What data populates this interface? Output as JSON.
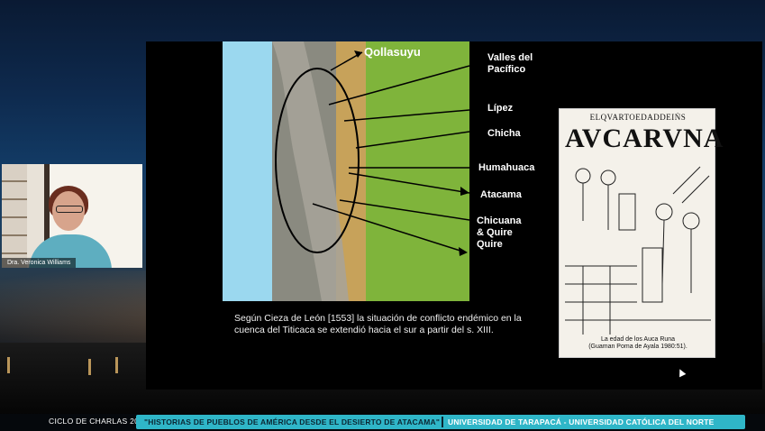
{
  "slide": {
    "map_title": "Qollasuyu",
    "labels": [
      "Valles del\nPacífico",
      "Lípez",
      "Chicha",
      "Humahuaca",
      "Atacama",
      "Chicuana\n& Quire\nQuire"
    ],
    "caption": "Según Cieza de León [1553] la situación de conflicto endémico en la cuenca del Titicaca se extendió hacia el sur a partir del s. XIII.",
    "drawing": {
      "title": "ELQVARTOEDADDEIṄS",
      "heading": "AVCARVNA",
      "caption_line1": "La edad de los Auca Runa",
      "caption_line2": "(Guaman Poma de Ayala 1980:51)."
    }
  },
  "webcam": {
    "name": "Dra. Veronica Williams"
  },
  "footer": {
    "series": "CICLO DE CHARLAS 2020",
    "title": "\"HISTORIAS DE PUEBLOS DE AMÉRICA DESDE EL DESIERTO DE ATACAMA\"",
    "universities": "UNIVERSIDAD DE TARAPACÁ - UNIVERSIDAD CATÓLICA DEL NORTE"
  },
  "colors": {
    "accent": "#2fb6c8",
    "slide_bg": "#000000"
  }
}
